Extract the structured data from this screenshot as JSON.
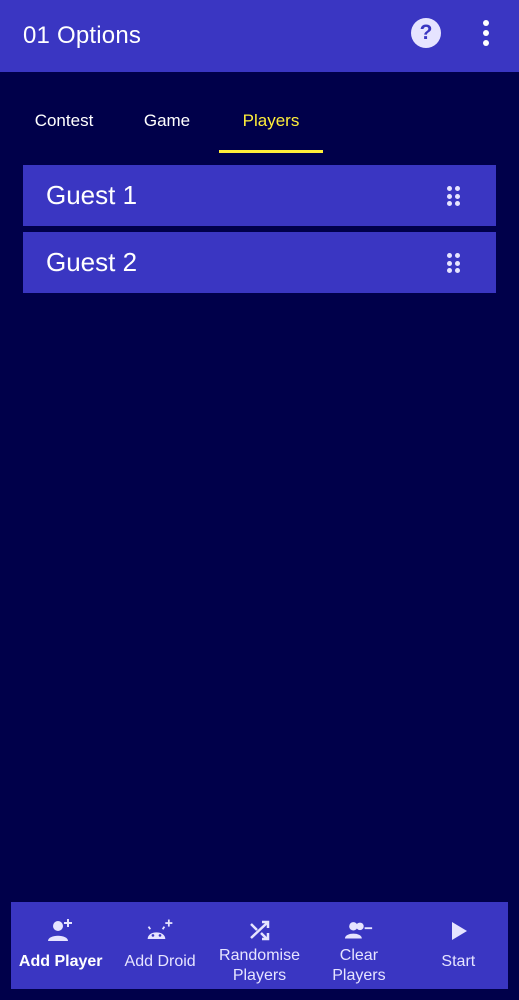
{
  "app_bar": {
    "title": "01 Options",
    "help_glyph": "?",
    "icons": [
      "help-icon",
      "more-vert-icon"
    ]
  },
  "tabs": [
    {
      "label": "Contest",
      "active": false
    },
    {
      "label": "Game",
      "active": false
    },
    {
      "label": "Players",
      "active": true
    }
  ],
  "players": [
    {
      "name": "Guest 1"
    },
    {
      "name": "Guest 2"
    }
  ],
  "bottom_bar": [
    {
      "label": "Add Player",
      "icon": "person-add-icon",
      "selected": true
    },
    {
      "label": "Add Droid",
      "icon": "android-add-icon",
      "selected": false
    },
    {
      "label": "Randomise\nPlayers",
      "icon": "shuffle-icon",
      "selected": false
    },
    {
      "label": "Clear\nPlayers",
      "icon": "group-remove-icon",
      "selected": false
    },
    {
      "label": "Start",
      "icon": "play-icon",
      "selected": false
    }
  ],
  "colors": {
    "background": "#00004a",
    "primary": "#3a36c2",
    "accent": "#ffee3a",
    "icon_light": "#e6e4ff"
  }
}
